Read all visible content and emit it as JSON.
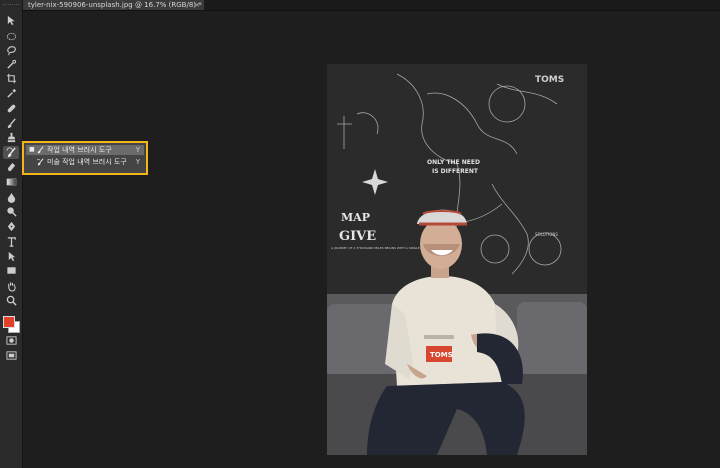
{
  "document_tab": {
    "title": "tyler-nix-590906-unsplash.jpg @ 16.7% (RGB/8) *",
    "close_glyph": "×"
  },
  "toolbar": {
    "tools": [
      "move-icon",
      "marquee-icon",
      "lasso-icon",
      "quick-select-icon",
      "crop-icon",
      "eyedropper-icon",
      "healing-brush-icon",
      "brush-icon",
      "clone-stamp-icon",
      "history-brush-icon",
      "eraser-icon",
      "gradient-icon",
      "blur-icon",
      "dodge-icon",
      "pen-icon",
      "type-icon",
      "path-select-icon",
      "rectangle-icon",
      "hand-icon",
      "zoom-icon"
    ],
    "active_tool": "history-brush-icon",
    "foreground_color": "#e2402b",
    "background_color": "#ffffff"
  },
  "flyout": {
    "items": [
      {
        "label": "작업 내역 브러시 도구",
        "shortcut": "Y",
        "selected": true
      },
      {
        "label": "미술 작업 내역 브러시 도구",
        "shortcut": "Y",
        "selected": false
      }
    ],
    "highlight_color": "#f3b51a"
  },
  "photo": {
    "map_title": "MAP",
    "map_subtitle": "GIVE",
    "map_caption": "A JOURNEY OF A THOUSAND MILES BEGINS WITH A SINGLE STEP",
    "phrase_1": "ONLY THE NEED",
    "phrase_2": "IS DIFFERENT",
    "compass_label": "SOLUTIONS",
    "cup_brand": "TOMS",
    "wall_brand": "TOMS"
  }
}
